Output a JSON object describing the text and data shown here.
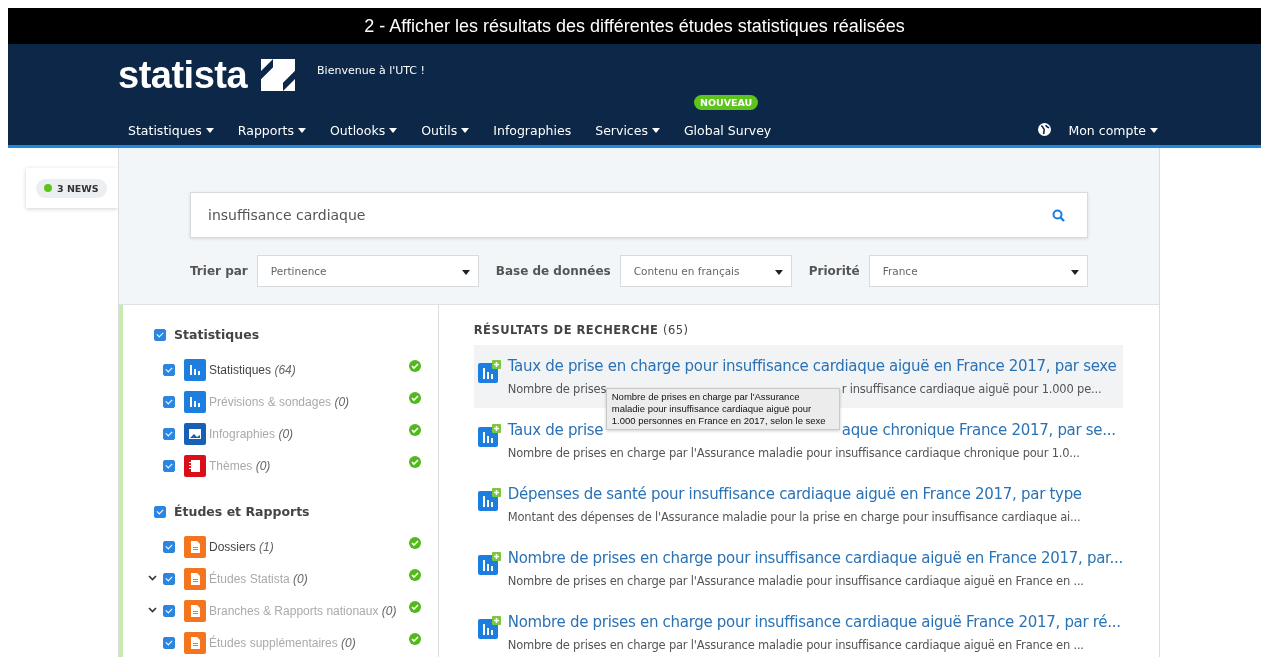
{
  "title_bar": {
    "title": "2 - Afficher les résultats des différentes études statistiques réalisées"
  },
  "header": {
    "logo": "statista",
    "welcome": "Bienvenue à l'UTC !",
    "nav": [
      {
        "label": "Statistiques",
        "dropdown": true
      },
      {
        "label": "Rapports",
        "dropdown": true
      },
      {
        "label": "Outlooks",
        "dropdown": true
      },
      {
        "label": "Outils",
        "dropdown": true
      },
      {
        "label": "Infographies",
        "dropdown": false
      },
      {
        "label": "Services",
        "dropdown": true
      },
      {
        "label": "Global Survey",
        "dropdown": false,
        "badge": "NOUVEAU"
      }
    ],
    "account": {
      "label": "Mon compte",
      "dropdown": true
    }
  },
  "news_badge": {
    "label": "3 NEWS",
    "color": "#5cc41a"
  },
  "search": {
    "value": "insuffisance cardiaque"
  },
  "filters": [
    {
      "label": "Trier par",
      "value": "Pertinence"
    },
    {
      "label": "Base de données",
      "value": "Contenu en français"
    },
    {
      "label": "Priorité",
      "value": "France"
    }
  ],
  "sidebar": {
    "groups": [
      {
        "label": "Statistiques",
        "checked": true,
        "children": [
          {
            "label": "Statistiques",
            "count": "(64)",
            "kind": "stat",
            "checked": true,
            "disabled": false,
            "expandable": false
          },
          {
            "label": "Prévisions & sondages",
            "count": "(0)",
            "kind": "forecast",
            "checked": true,
            "disabled": true,
            "expandable": false
          },
          {
            "label": "Infographies",
            "count": "(0)",
            "kind": "infographic",
            "checked": true,
            "disabled": true,
            "expandable": false
          },
          {
            "label": "Thèmes",
            "count": "(0)",
            "kind": "topic",
            "checked": true,
            "disabled": true,
            "expandable": false
          }
        ]
      },
      {
        "label": "Études et Rapports",
        "checked": true,
        "children": [
          {
            "label": "Dossiers",
            "count": "(1)",
            "kind": "dossier",
            "checked": true,
            "disabled": false,
            "expandable": false
          },
          {
            "label": "Études Statista",
            "count": "(0)",
            "kind": "study",
            "checked": true,
            "disabled": true,
            "expandable": true
          },
          {
            "label": "Branches & Rapports nationaux",
            "count": "(0)",
            "kind": "study",
            "checked": true,
            "disabled": true,
            "expandable": true
          },
          {
            "label": "Études supplémentaires",
            "count": "(0)",
            "kind": "study",
            "checked": true,
            "disabled": true,
            "expandable": false
          }
        ]
      }
    ]
  },
  "results": {
    "heading": "RÉSULTATS DE RECHERCHE",
    "count": "(65)",
    "items": [
      {
        "title": [
          "Taux de prise en charge pour insuffisance cardiaque aiguë en France 2017, par sexe"
        ],
        "description": [
          "Nombre de prises",
          "r insuffisance cardiaque aiguë pour 1.000 pe..."
        ],
        "selected": true,
        "tooltip": "Nombre de prises en charge par l'Assurance maladie pour insuffisance cardiaque aiguë pour 1.000 personnes en France en 2017, selon le sexe"
      },
      {
        "title": [
          "Taux de prise",
          "aque chronique France 2017, par se..."
        ],
        "description": [
          "Nombre de prises en charge par l'Assurance maladie pour insuffisance cardiaque chronique pour 1.0..."
        ],
        "selected": false
      },
      {
        "title": [
          "Dépenses de santé pour insuffisance cardiaque aiguë en France 2017, par type"
        ],
        "description": [
          "Montant des dépenses de l'Assurance maladie pour la prise en charge pour insuffisance cardiaque ai..."
        ],
        "selected": false
      },
      {
        "title": [
          "Nombre de prises en charge pour insuffisance cardiaque aiguë en France 2017, par..."
        ],
        "description": [
          "Nombre de prises en charge par l'Assurance maladie pour insuffisance cardiaque aiguë en France en ..."
        ],
        "selected": false
      },
      {
        "title": [
          "Nombre de prises en charge pour insuffisance cardiaque aiguë France 2017, par ré..."
        ],
        "description": [
          "Nombre de prises en charge par l'Assurance maladie pour insuffisance cardiaque aiguë en France en ..."
        ],
        "selected": false
      }
    ]
  }
}
